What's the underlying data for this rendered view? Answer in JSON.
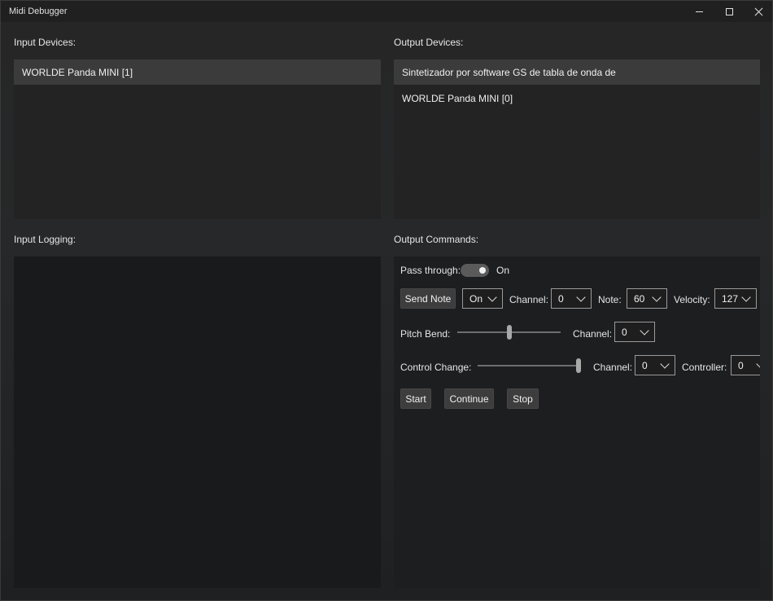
{
  "window": {
    "title": "Midi Debugger"
  },
  "input_devices": {
    "label": "Input Devices:",
    "items": [
      {
        "label": "WORLDE Panda MINI [1]",
        "selected": true
      }
    ]
  },
  "output_devices": {
    "label": "Output Devices:",
    "items": [
      {
        "label": "Sintetizador por software GS de tabla de onda de",
        "selected": true
      },
      {
        "label": "WORLDE Panda MINI [0]",
        "selected": false
      }
    ]
  },
  "input_logging": {
    "label": "Input Logging:"
  },
  "output_commands": {
    "label": "Output Commands:",
    "pass_through": {
      "label": "Pass through:",
      "state": "On"
    },
    "note_row": {
      "send_label": "Send Note",
      "on_off": "On",
      "channel_label": "Channel:",
      "channel": "0",
      "note_label": "Note:",
      "note": "60",
      "velocity_label": "Velocity:",
      "velocity": "127"
    },
    "pitch_bend": {
      "label": "Pitch Bend:",
      "level": 0.5,
      "channel_label": "Channel:",
      "channel": "0"
    },
    "control_change": {
      "label": "Control Change:",
      "level": 1.0,
      "channel_label": "Channel:",
      "channel": "0",
      "controller_label": "Controller:",
      "controller": "0"
    },
    "transport": {
      "start": "Start",
      "continue": "Continue",
      "stop": "Stop"
    }
  },
  "icons": {
    "minimize": "minimize-icon",
    "maximize": "maximize-icon",
    "close": "close-icon",
    "dropdown": "chevron-down-icon"
  }
}
